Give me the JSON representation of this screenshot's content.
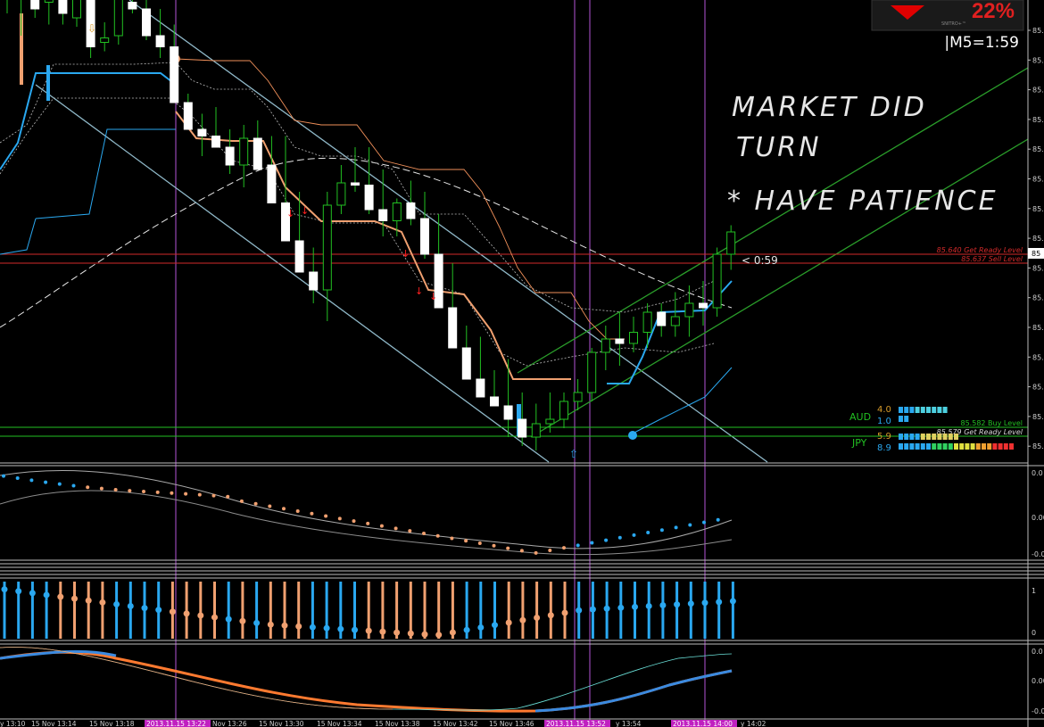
{
  "signal_badge": {
    "percent": "22%",
    "brand": "SNITRO+™",
    "arrow": "down-triangle-icon",
    "arrow_color": "#e00000"
  },
  "timer_label": "|M5=1:59",
  "countdown": "< 0:59",
  "annotation": {
    "line1": "MARKET DID",
    "line2": "TURN",
    "line3": "* HAVE PATIENCE"
  },
  "levels": [
    {
      "price": 85.64,
      "label": "85.640 Get Ready Level",
      "color": "#d22a2a"
    },
    {
      "price": 85.637,
      "label": "85.637 Sell Level",
      "color": "#d22a2a"
    },
    {
      "price": 85.582,
      "label": "85.582 Buy Level",
      "color": "#22c022"
    },
    {
      "price": 85.579,
      "label": "85.579 Get Ready Level",
      "color": "#d8d8d8"
    }
  ],
  "strength": [
    {
      "currency": "AUD",
      "values": [
        "4.0",
        "1.0"
      ]
    },
    {
      "currency": "JPY",
      "values": [
        "5.9",
        "8.9"
      ]
    }
  ],
  "price_axis_labels": [
    "85.",
    "85.",
    "85.",
    "85.",
    "85.",
    "85.",
    "85.",
    "85.",
    "85.",
    "85.",
    "85.",
    "85.",
    "85.",
    "85.",
    "85.",
    "85."
  ],
  "price_tag": "85",
  "osc_axis_labels": [
    "0.0",
    "0.00",
    "-0.0"
  ],
  "hist_axis_labels": [
    "1",
    "0"
  ],
  "macd_axis_labels": [
    "0.0",
    "0.00",
    "-0.0"
  ],
  "time_labels": [
    "y 13:10",
    "15 Nov 13:14",
    "15 Nov 13:18",
    "Nov 13:26",
    "15 Nov 13:30",
    "15 Nov 13:34",
    "15 Nov 13:38",
    "15 Nov 13:42",
    "15 Nov 13:46",
    "y 13:54",
    "y 14:02"
  ],
  "time_markers": [
    "2013.11.15 13:22",
    "2013.11.15 13:52",
    "2013.11.15 14:00"
  ],
  "chart_data": {
    "type": "candlestick",
    "symbol_pair": "AUDJPY",
    "timeframe": "M5",
    "series": [
      {
        "name": "candles",
        "ohlc": [
          [
            0.62,
            0.85,
            0.5,
            0.6
          ],
          [
            0.58,
            0.7,
            0.4,
            0.66
          ],
          [
            0.66,
            0.72,
            0.48,
            0.52
          ],
          [
            0.55,
            0.62,
            0.45,
            0.58
          ],
          [
            0.58,
            0.62,
            0.45,
            0.5
          ],
          [
            0.48,
            0.62,
            0.44,
            0.6
          ],
          [
            0.6,
            0.63,
            0.3,
            0.35
          ],
          [
            0.37,
            0.46,
            0.33,
            0.39
          ],
          [
            0.4,
            0.6,
            0.36,
            0.58
          ],
          [
            0.55,
            0.62,
            0.5,
            0.52
          ],
          [
            0.52,
            0.57,
            0.38,
            0.4
          ],
          [
            0.4,
            0.52,
            0.3,
            0.35
          ],
          [
            0.35,
            0.45,
            0.18,
            0.1
          ],
          [
            0.1,
            0.14,
            0.0,
            -0.02
          ],
          [
            -0.02,
            0.05,
            -0.14,
            -0.05
          ],
          [
            -0.05,
            0.08,
            -0.1,
            -0.1
          ],
          [
            -0.1,
            -0.02,
            -0.22,
            -0.18
          ],
          [
            -0.18,
            0.0,
            -0.28,
            -0.06
          ],
          [
            -0.06,
            0.02,
            -0.18,
            -0.2
          ],
          [
            -0.18,
            -0.05,
            -0.28,
            -0.35
          ],
          [
            -0.35,
            -0.05,
            -0.42,
            -0.52
          ],
          [
            -0.52,
            -0.3,
            -0.55,
            -0.66
          ],
          [
            -0.66,
            -0.55,
            -0.8,
            -0.74
          ],
          [
            -0.74,
            -0.3,
            -0.88,
            -0.36
          ],
          [
            -0.36,
            -0.18,
            -0.4,
            -0.26
          ],
          [
            -0.26,
            -0.1,
            -0.3,
            -0.27
          ],
          [
            -0.27,
            -0.1,
            -0.4,
            -0.38
          ],
          [
            -0.38,
            -0.2,
            -0.5,
            -0.43
          ],
          [
            -0.43,
            -0.33,
            -0.5,
            -0.35
          ],
          [
            -0.35,
            -0.25,
            -0.45,
            -0.42
          ],
          [
            -0.42,
            -0.3,
            -0.6,
            -0.58
          ],
          [
            -0.58,
            -0.4,
            -0.72,
            -0.82
          ],
          [
            -0.82,
            -0.62,
            -0.98,
            -1.0
          ],
          [
            -1.0,
            -0.9,
            -1.06,
            -1.14
          ],
          [
            -1.14,
            -0.95,
            -1.2,
            -1.22
          ],
          [
            -1.22,
            -1.1,
            -1.26,
            -1.26
          ],
          [
            -1.26,
            -1.05,
            -1.4,
            -1.32
          ],
          [
            -1.32,
            -1.2,
            -1.44,
            -1.4
          ],
          [
            -1.4,
            -1.25,
            -1.46,
            -1.34
          ],
          [
            -1.34,
            -1.2,
            -1.38,
            -1.32
          ],
          [
            -1.32,
            -1.2,
            -1.36,
            -1.24
          ],
          [
            -1.24,
            -1.14,
            -1.28,
            -1.2
          ],
          [
            -1.2,
            -1.0,
            -1.24,
            -1.02
          ],
          [
            -1.02,
            -0.9,
            -1.1,
            -0.96
          ],
          [
            -0.96,
            -0.84,
            -1.08,
            -0.98
          ],
          [
            -0.98,
            -0.86,
            -1.02,
            -0.93
          ],
          [
            -0.93,
            -0.8,
            -1.0,
            -0.84
          ],
          [
            -0.84,
            -0.8,
            -0.95,
            -0.9
          ],
          [
            -0.9,
            -0.75,
            -0.95,
            -0.86
          ],
          [
            -0.86,
            -0.72,
            -0.95,
            -0.8
          ],
          [
            -0.8,
            -0.7,
            -0.9,
            -0.82
          ],
          [
            -0.82,
            -0.55,
            -0.86,
            -0.58
          ],
          [
            -0.58,
            -0.45,
            -0.65,
            -0.48
          ]
        ]
      }
    ]
  }
}
